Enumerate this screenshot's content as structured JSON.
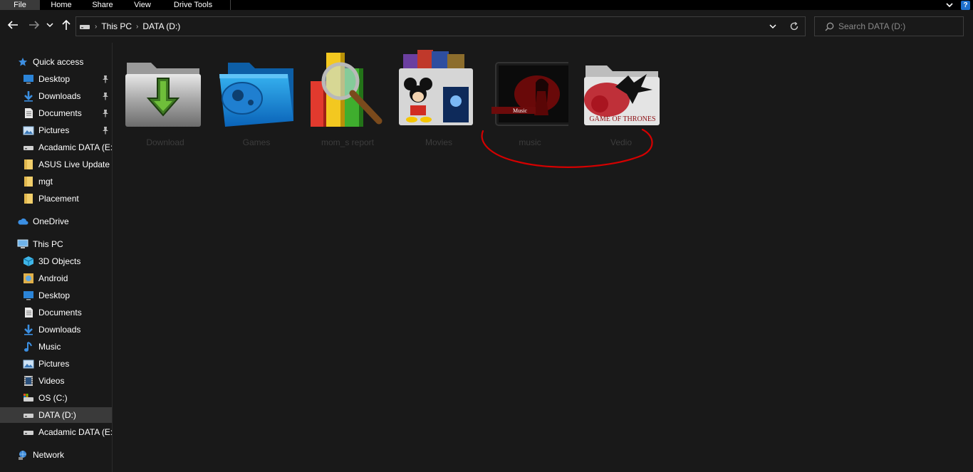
{
  "ribbon": {
    "tabs": [
      {
        "label": "File"
      },
      {
        "label": "Home"
      },
      {
        "label": "Share"
      },
      {
        "label": "View"
      },
      {
        "label": "Drive Tools"
      }
    ],
    "help_label": "?"
  },
  "address": {
    "crumbs": [
      "This PC",
      "DATA (D:)"
    ]
  },
  "search": {
    "placeholder": "Search DATA (D:)"
  },
  "sidebar": {
    "quick_access": "Quick access",
    "quick_items": [
      {
        "label": "Desktop",
        "icon": "desktop-icon",
        "pinned": true
      },
      {
        "label": "Downloads",
        "icon": "download-icon",
        "pinned": true
      },
      {
        "label": "Documents",
        "icon": "document-icon",
        "pinned": true
      },
      {
        "label": "Pictures",
        "icon": "pictures-icon",
        "pinned": true
      },
      {
        "label": "Acadamic DATA (E:)",
        "icon": "drive-icon",
        "pinned": false
      },
      {
        "label": "ASUS Live Update",
        "icon": "folder-icon",
        "pinned": false
      },
      {
        "label": "mgt",
        "icon": "folder-icon",
        "pinned": false
      },
      {
        "label": "Placement",
        "icon": "folder-icon",
        "pinned": false
      }
    ],
    "onedrive": "OneDrive",
    "this_pc": "This PC",
    "pc_items": [
      {
        "label": "3D Objects",
        "icon": "3d-objects-icon"
      },
      {
        "label": "Android",
        "icon": "android-icon"
      },
      {
        "label": "Desktop",
        "icon": "desktop-icon"
      },
      {
        "label": "Documents",
        "icon": "document-icon"
      },
      {
        "label": "Downloads",
        "icon": "download-icon"
      },
      {
        "label": "Music",
        "icon": "music-icon"
      },
      {
        "label": "Pictures",
        "icon": "pictures-icon"
      },
      {
        "label": "Videos",
        "icon": "videos-icon"
      },
      {
        "label": "OS (C:)",
        "icon": "os-drive-icon"
      },
      {
        "label": "DATA (D:)",
        "icon": "drive-icon",
        "selected": true
      },
      {
        "label": "Acadamic DATA (E:)",
        "icon": "drive-icon"
      }
    ],
    "network": "Network"
  },
  "folders": [
    {
      "label": "Download",
      "icon": "download-folder-icon"
    },
    {
      "label": "Games",
      "icon": "games-folder-icon"
    },
    {
      "label": "mom_s report",
      "icon": "report-folder-icon"
    },
    {
      "label": "Movies",
      "icon": "movies-folder-icon"
    },
    {
      "label": "music",
      "icon": "music-folder-icon",
      "art_text": "Music"
    },
    {
      "label": "Vedio",
      "icon": "game-of-thrones-folder-icon",
      "art_text": "GAME OF THRONES"
    }
  ],
  "colors": {
    "background": "#191919",
    "selected": "#3a3a3a",
    "annotation": "#d40000",
    "accent": "#1e70cd"
  }
}
